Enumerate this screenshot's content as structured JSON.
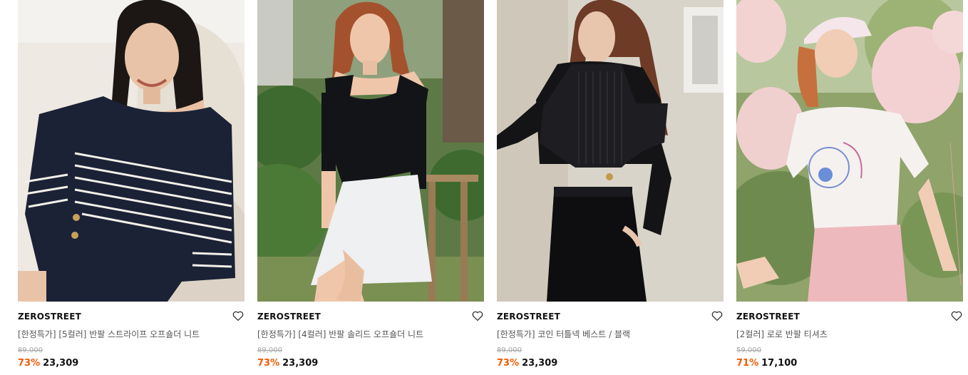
{
  "colors": {
    "discount": "#f25c05",
    "text": "#111111",
    "subtext": "#555555",
    "strike": "#a5a5a5"
  },
  "products": [
    {
      "brand": "ZEROSTREET",
      "title": "[한정특가] [5컬러] 반팔 스트라이프 오프숄더 니트",
      "original_price": "89,000",
      "discount": "73%",
      "price": "23,309",
      "wishlist_icon": "heart-outline-icon"
    },
    {
      "brand": "ZEROSTREET",
      "title": "[한정특가] [4컬러] 반팔 솔리드 오프숄더 니트",
      "original_price": "89,000",
      "discount": "73%",
      "price": "23,309",
      "wishlist_icon": "heart-outline-icon"
    },
    {
      "brand": "ZEROSTREET",
      "title": "[한정특가] 코인 터틀넥 베스트 / 블랙",
      "original_price": "89,000",
      "discount": "73%",
      "price": "23,309",
      "wishlist_icon": "heart-outline-icon"
    },
    {
      "brand": "ZEROSTREET",
      "title": "[2컬러] 로로 반팔 티셔츠",
      "original_price": "59,000",
      "discount": "71%",
      "price": "17,100",
      "wishlist_icon": "heart-outline-icon"
    }
  ]
}
